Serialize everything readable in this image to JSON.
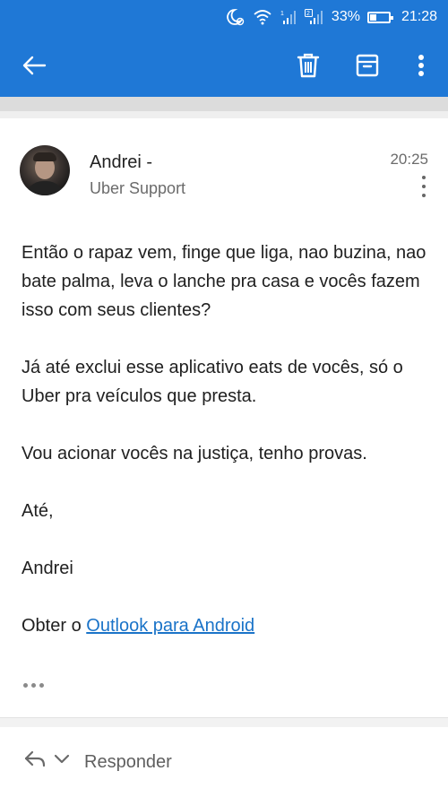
{
  "status_bar": {
    "battery_percent": "33%",
    "time": "21:28",
    "icons": [
      "moon-alarm-icon",
      "wifi-icon",
      "signal-1-icon",
      "signal-2-icon",
      "battery-icon"
    ]
  },
  "toolbar": {
    "back_icon": "arrow-left-icon",
    "actions": [
      "trash-icon",
      "archive-icon",
      "more-vertical-icon"
    ]
  },
  "email": {
    "sender_name": "Andrei -",
    "sender_subtitle": "Uber Support",
    "time": "20:25",
    "paragraphs": [
      "Então o rapaz vem, finge que liga, nao buzina, nao bate palma, leva o lanche pra casa e vocês fazem isso com seus clientes?",
      "Já até exclui esse aplicativo eats de vocês, só o Uber pra veículos que presta.",
      "Vou acionar vocês na justiça, tenho provas.",
      "Até,",
      "Andrei"
    ],
    "signature_prefix": "Obter o ",
    "signature_link": "Outlook para Android"
  },
  "reply": {
    "label": "Responder"
  },
  "colors": {
    "accent": "#1f78d6",
    "link": "#1a73c8"
  }
}
